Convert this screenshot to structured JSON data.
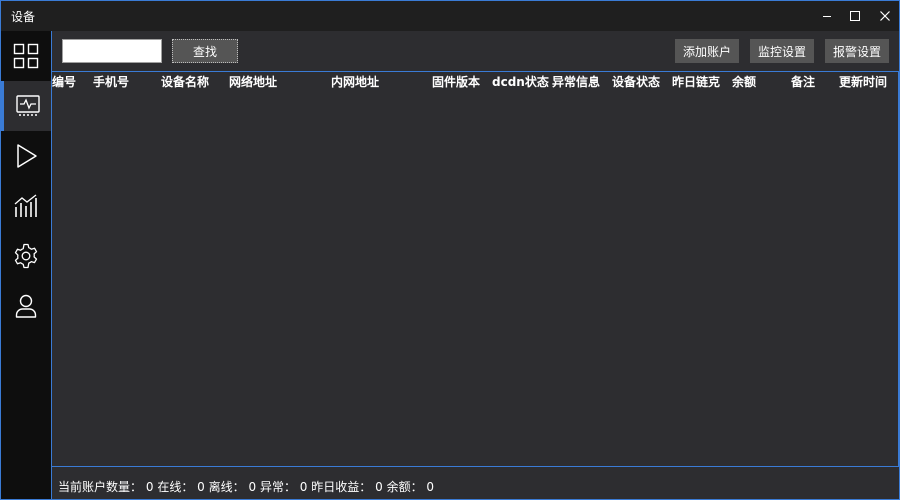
{
  "window": {
    "title": "设备",
    "accent": "#3a7bd5"
  },
  "sidebar": {
    "items": [
      {
        "name": "dashboard",
        "icon": "grid-icon",
        "active": false
      },
      {
        "name": "devices",
        "icon": "monitor-icon",
        "active": true
      },
      {
        "name": "play",
        "icon": "play-icon",
        "active": false
      },
      {
        "name": "stats",
        "icon": "chart-icon",
        "active": false
      },
      {
        "name": "settings",
        "icon": "gear-icon",
        "active": false
      },
      {
        "name": "user",
        "icon": "user-icon",
        "active": false
      }
    ]
  },
  "toolbar": {
    "search_value": "",
    "find_label": "查找",
    "add_account_label": "添加账户",
    "monitor_settings_label": "监控设置",
    "alarm_settings_label": "报警设置"
  },
  "table": {
    "columns": [
      "编号",
      "手机号",
      "设备名称",
      "网络地址",
      "内网地址",
      "固件版本",
      "dcdn状态",
      "异常信息",
      "设备状态",
      "昨日链克",
      "余额",
      "备注",
      "更新时间"
    ],
    "rows": []
  },
  "status": {
    "account_count_label": "当前账户数量：",
    "account_count": "0",
    "online_label": "在线：",
    "online": "0",
    "offline_label": "离线：",
    "offline": "0",
    "abnormal_label": "异常：",
    "abnormal": "0",
    "yesterday_income_label": "昨日收益：",
    "yesterday_income": "0",
    "balance_label": "余额：",
    "balance": "0"
  }
}
